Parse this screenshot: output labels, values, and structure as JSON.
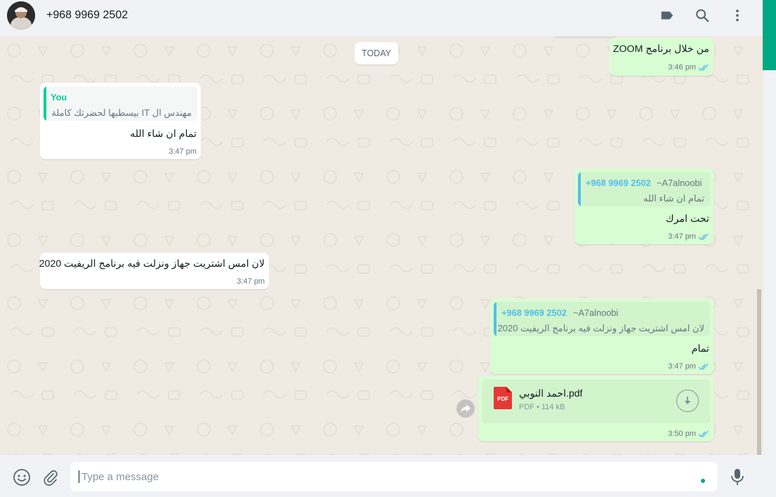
{
  "header": {
    "contact_name": "+968 9969 2502",
    "icons": [
      "label-icon",
      "search-icon",
      "menu-icon"
    ]
  },
  "chat": {
    "date_separator": "TODAY",
    "messages": [
      {
        "direction": "outgoing",
        "text": "من خلال برنامج ZOOM",
        "time": "3:46 pm",
        "status": "read"
      },
      {
        "direction": "incoming",
        "quote_author": "You",
        "quote_text": "مهندس ال IT بيسطبها لحضرتك كاملة",
        "text": "تمام ان شاء الله",
        "time": "3:47 pm"
      },
      {
        "direction": "outgoing",
        "quote_author": "+968 9969 2502",
        "quote_pushname": "~A7alnoobi",
        "quote_text": "تمام ان شاء الله",
        "text": "تحت امرك",
        "time": "3:47 pm",
        "status": "read"
      },
      {
        "direction": "incoming",
        "text": "لان امس اشتريت جهاز ونزلت فيه برنامج الريفيت 2020",
        "time": "3:47 pm"
      },
      {
        "direction": "outgoing",
        "quote_author": "+968 9969 2502",
        "quote_pushname": "~A7alnoobi",
        "quote_text": "لان امس اشتريت جهاز ونزلت فيه برنامج الريفيت 2020",
        "text": "تمام",
        "time": "3:47 pm",
        "status": "read"
      },
      {
        "direction": "outgoing",
        "type": "document",
        "file_icon_label": "PDF",
        "file_name": "احمد النوبي.pdf",
        "file_type": "PDF",
        "file_size": "114 kB",
        "time": "3:50 pm",
        "status": "read"
      }
    ]
  },
  "footer": {
    "placeholder": "Type a message",
    "icons": [
      "emoji-icon",
      "attach-icon",
      "mic-icon"
    ]
  },
  "colors": {
    "chat_background": "#efeae2",
    "incoming_bubble": "#ffffff",
    "outgoing_bubble": "#d9fdd3",
    "accent": "#00a884",
    "read_ticks": "#53bdeb",
    "quote_you": "#06cf9c",
    "quote_contact": "#53bdeb",
    "pdf_red": "#e53935"
  }
}
